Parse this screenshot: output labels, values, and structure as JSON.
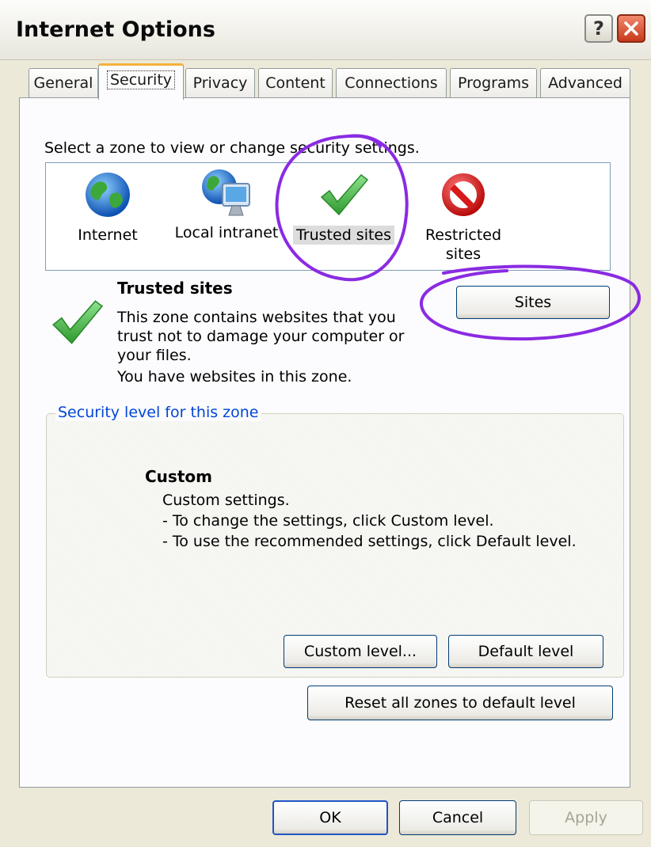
{
  "window": {
    "title": "Internet Options"
  },
  "titlebar": {
    "help_glyph": "?"
  },
  "tabs": [
    {
      "label": "General",
      "active": false
    },
    {
      "label": "Security",
      "active": true
    },
    {
      "label": "Privacy",
      "active": false
    },
    {
      "label": "Content",
      "active": false
    },
    {
      "label": "Connections",
      "active": false
    },
    {
      "label": "Programs",
      "active": false
    },
    {
      "label": "Advanced",
      "active": false
    }
  ],
  "security": {
    "zone_prompt": "Select a zone to view or change security settings.",
    "zones": [
      {
        "label": "Internet",
        "icon": "globe-icon"
      },
      {
        "label": "Local intranet",
        "icon": "intranet-globe-monitor-icon"
      },
      {
        "label": "Trusted sites",
        "icon": "checkmark-icon",
        "selected": true
      },
      {
        "label_line1": "Restricted",
        "label_line2": "sites",
        "icon": "prohibited-icon"
      }
    ],
    "selected_zone": {
      "title": "Trusted sites",
      "description": "This zone contains websites that you trust not to damage your computer or your files.",
      "status": "You have websites in this zone.",
      "sites_button": "Sites"
    },
    "level": {
      "legend": "Security level for this zone",
      "name": "Custom",
      "lines": [
        "Custom settings.",
        "- To change the settings, click Custom level.",
        "- To use the recommended settings, click Default level."
      ],
      "custom_level_button": "Custom level...",
      "default_level_button": "Default level"
    },
    "reset_button": "Reset all zones to default level"
  },
  "footer": {
    "ok": "OK",
    "cancel": "Cancel",
    "apply": "Apply"
  },
  "colors": {
    "annotation": "#8a2be2",
    "legend_text": "#0046d5",
    "check_green": "#3cb83c",
    "prohibited_red": "#d81a1a"
  }
}
